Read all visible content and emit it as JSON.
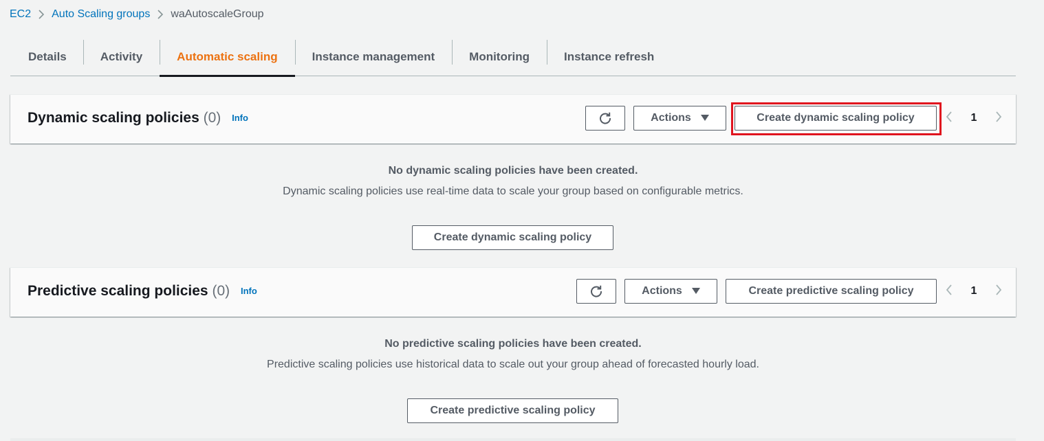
{
  "breadcrumb": {
    "items": [
      "EC2",
      "Auto Scaling groups"
    ],
    "current": "waAutoscaleGroup"
  },
  "tabs": [
    "Details",
    "Activity",
    "Automatic scaling",
    "Instance management",
    "Monitoring",
    "Instance refresh"
  ],
  "active_tab": "Automatic scaling",
  "dynamic": {
    "title": "Dynamic scaling policies",
    "count": "(0)",
    "info": "Info",
    "actions_label": "Actions",
    "create_label": "Create dynamic scaling policy",
    "page": "1",
    "empty_title": "No dynamic scaling policies have been created.",
    "empty_desc": "Dynamic scaling policies use real-time data to scale your group based on configurable metrics.",
    "empty_button": "Create dynamic scaling policy",
    "create_highlighted": true
  },
  "predictive": {
    "title": "Predictive scaling policies",
    "count": "(0)",
    "info": "Info",
    "actions_label": "Actions",
    "create_label": "Create predictive scaling policy",
    "page": "1",
    "empty_title": "No predictive scaling policies have been created.",
    "empty_desc": "Predictive scaling policies use historical data to scale out your group ahead of forecasted hourly load.",
    "empty_button": "Create predictive scaling policy"
  },
  "icons": {
    "refresh": "refresh-icon",
    "caret": "caret-down-icon",
    "prev": "chevron-left-icon",
    "next": "chevron-right-icon",
    "breadcrumb_separator": "chevron-right-icon"
  },
  "colors": {
    "link": "#0073bb",
    "active_tab": "#ec7211",
    "highlight": "#e0141e",
    "background": "#f2f3f3"
  }
}
